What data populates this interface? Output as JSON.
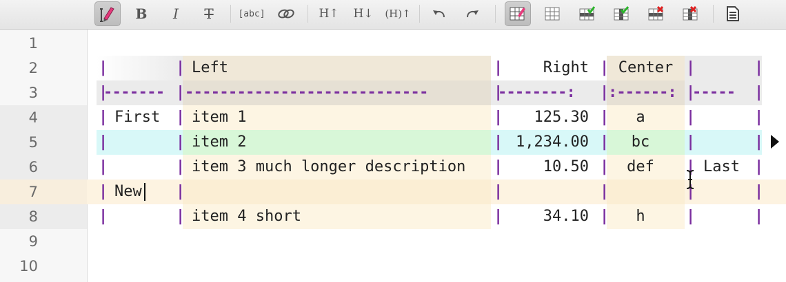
{
  "toolbar": {
    "buttons": [
      {
        "name": "pencil-icon",
        "glyph": ""
      },
      {
        "name": "bold-button",
        "glyph": "B"
      },
      {
        "name": "italic-button",
        "glyph": "I"
      },
      {
        "name": "strikethrough-button",
        "glyph": "T"
      },
      {
        "name": "code-button",
        "glyph": "[abc]"
      },
      {
        "name": "link-icon",
        "glyph": ""
      },
      {
        "name": "heading-up-button",
        "glyph": "H↑"
      },
      {
        "name": "heading-down-button",
        "glyph": "H↓"
      },
      {
        "name": "heading-toggle-button",
        "glyph": "(H)↑"
      },
      {
        "name": "undo-icon",
        "glyph": ""
      },
      {
        "name": "redo-icon",
        "glyph": ""
      },
      {
        "name": "table-edit-icon",
        "glyph": ""
      },
      {
        "name": "table-icon",
        "glyph": ""
      },
      {
        "name": "table-insert-row-icon",
        "glyph": ""
      },
      {
        "name": "table-insert-column-icon",
        "glyph": ""
      },
      {
        "name": "table-delete-row-icon",
        "glyph": ""
      },
      {
        "name": "table-delete-column-icon",
        "glyph": ""
      },
      {
        "name": "preview-icon",
        "glyph": ""
      }
    ]
  },
  "line_numbers": [
    "1",
    "2",
    "3",
    "4",
    "5",
    "6",
    "7",
    "8",
    "9",
    "10"
  ],
  "table": {
    "header": [
      "",
      "Left",
      "Right",
      "Center",
      ""
    ],
    "separator": [
      "-------",
      "----------------------------",
      "--------:",
      ":------:",
      "-----"
    ],
    "rows": [
      [
        "First",
        "item 1",
        "125.30",
        "a",
        ""
      ],
      [
        "",
        "item 2",
        "1,234.00",
        "bc",
        ""
      ],
      [
        "",
        "item 3 much longer description",
        "10.50",
        "def",
        "Last"
      ],
      [
        "New",
        "",
        "",
        "",
        ""
      ],
      [
        "",
        "item 4 short",
        "34.10",
        "h",
        ""
      ]
    ]
  },
  "pipe": "|",
  "colors": {
    "accent_pipe": "#7a2d9e",
    "column_left_bg": "#fdf5e3",
    "column_center_bg": "#fdf5e3",
    "header_bg": "#f0e8d8",
    "selected_row_bg": "#d8f7e0",
    "selected_row_cyan": "#d8f8f8",
    "current_line_bg": "#fdf3e1"
  }
}
